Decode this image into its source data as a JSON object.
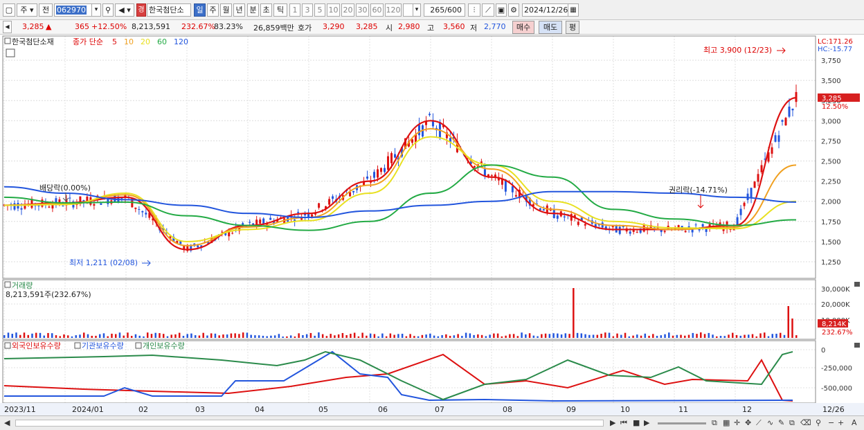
{
  "toolbar": {
    "market": "주",
    "period_prev": "전",
    "code": "062970",
    "stock_name": "한국첨단소",
    "badge": "경",
    "periods": [
      "일",
      "주",
      "월",
      "년",
      "분",
      "초",
      "틱"
    ],
    "active_period": "일",
    "intervals": [
      "1",
      "3",
      "5",
      "10",
      "20",
      "30",
      "60",
      "120"
    ],
    "count": "265",
    "count_max": "/600",
    "date": "2024/12/26"
  },
  "quote": {
    "price": "3,285",
    "change_arrow": "▲",
    "change": "365",
    "change_pct": "+12.50%",
    "volume": "8,213,591",
    "volume_ratio": "232.67%",
    "rate": "83.23%",
    "amount": "26,859백만",
    "bid_label": "호가",
    "ask_price": "3,290",
    "bid_price": "3,285",
    "open_label": "시",
    "open": "2,980",
    "high_label": "고",
    "high": "3,560",
    "low_label": "저",
    "low": "2,770",
    "buy_label": "매수",
    "sell_label": "매도",
    "avg_label": "평"
  },
  "price_panel": {
    "stock_label": "한국첨단소재",
    "ma_label": "종가 단순",
    "ma_periods": [
      {
        "label": "5",
        "color": "#dd1111"
      },
      {
        "label": "10",
        "color": "#f0a020"
      },
      {
        "label": "20",
        "color": "#e8e020"
      },
      {
        "label": "60",
        "color": "#22aa44"
      },
      {
        "label": "120",
        "color": "#2255dd"
      }
    ],
    "lc": "LC:171.26",
    "hc": "HC:-15.77",
    "axis_ticks": [
      "3,750",
      "3,500",
      "3,250",
      "3,000",
      "2,750",
      "2,500",
      "2,250",
      "2,000",
      "1,750",
      "1,500",
      "1,250"
    ],
    "current_price": "3,285",
    "current_pct": "12.50%",
    "annotations": {
      "high": "최고 3,900 (12/23)",
      "low": "최저 1,211 (02/08)",
      "dividend": "배당락(0.00%)",
      "rights": "권리락(-14.71%)"
    }
  },
  "volume_panel": {
    "label": "거래량",
    "value": "8,213,591주(232.67%)",
    "axis_ticks": [
      "30,000K",
      "20,000K",
      "10,000K"
    ],
    "current": "8,214K",
    "current_pct": "232.67%"
  },
  "holdings_panel": {
    "labels": [
      "외국인보유수량",
      "기관보유수량",
      "개인보유수량"
    ],
    "colors": [
      "#dd1111",
      "#2255dd",
      "#2a8a4a"
    ],
    "axis_ticks": [
      "0",
      "-250,000",
      "-500,000"
    ]
  },
  "x_axis": {
    "labels": [
      "2023/11",
      "2024/01",
      "02",
      "03",
      "04",
      "05",
      "06",
      "07",
      "08",
      "09",
      "10",
      "11",
      "12",
      "12/26"
    ]
  },
  "chart_data": {
    "type": "line",
    "title": "한국첨단소재",
    "x": [
      "2023/11",
      "2024/01",
      "02",
      "03",
      "04",
      "05",
      "06",
      "07",
      "08",
      "09",
      "10",
      "11",
      "12",
      "12/26"
    ],
    "ylim": [
      1100,
      3900
    ],
    "series": [
      {
        "name": "5",
        "values": [
          1950,
          1980,
          2050,
          1400,
          1700,
          1850,
          2250,
          3000,
          2300,
          1850,
          1650,
          1650,
          1700,
          3285
        ]
      },
      {
        "name": "10",
        "values": [
          1950,
          1970,
          2080,
          1450,
          1680,
          1800,
          2200,
          2900,
          2400,
          1900,
          1700,
          1650,
          1680,
          2450
        ]
      },
      {
        "name": "20",
        "values": [
          1950,
          1960,
          2100,
          1500,
          1650,
          1760,
          2100,
          2800,
          2450,
          2000,
          1750,
          1670,
          1660,
          2000
        ]
      },
      {
        "name": "60",
        "values": [
          2050,
          1980,
          1990,
          1820,
          1700,
          1640,
          1750,
          2100,
          2450,
          2300,
          1900,
          1780,
          1700,
          1770
        ]
      },
      {
        "name": "120",
        "values": [
          2180,
          2100,
          2020,
          1950,
          1850,
          1800,
          1880,
          1950,
          2000,
          2120,
          2120,
          2100,
          2050,
          1990
        ]
      }
    ]
  }
}
